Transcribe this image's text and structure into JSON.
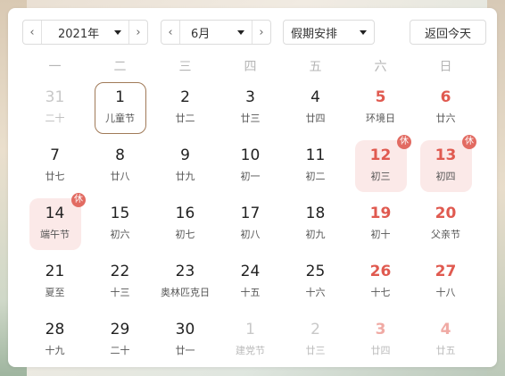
{
  "toolbar": {
    "year_value": "2021年",
    "month_value": "6月",
    "holiday_value": "假期安排",
    "today_label": "返回今天",
    "prev_glyph": "‹",
    "next_glyph": "›"
  },
  "weekdays": [
    "一",
    "二",
    "三",
    "四",
    "五",
    "六",
    "日"
  ],
  "rest_badge": "休",
  "weeks": [
    [
      {
        "day": "31",
        "sub": "二十",
        "type": "other"
      },
      {
        "day": "1",
        "sub": "儿童节",
        "type": "today"
      },
      {
        "day": "2",
        "sub": "廿二",
        "type": "normal"
      },
      {
        "day": "3",
        "sub": "廿三",
        "type": "normal"
      },
      {
        "day": "4",
        "sub": "廿四",
        "type": "normal"
      },
      {
        "day": "5",
        "sub": "环境日",
        "type": "weekend"
      },
      {
        "day": "6",
        "sub": "廿六",
        "type": "weekend"
      }
    ],
    [
      {
        "day": "7",
        "sub": "廿七",
        "type": "normal"
      },
      {
        "day": "8",
        "sub": "廿八",
        "type": "normal"
      },
      {
        "day": "9",
        "sub": "廿九",
        "type": "normal"
      },
      {
        "day": "10",
        "sub": "初一",
        "type": "normal"
      },
      {
        "day": "11",
        "sub": "初二",
        "type": "normal"
      },
      {
        "day": "12",
        "sub": "初三",
        "type": "weekend holiday"
      },
      {
        "day": "13",
        "sub": "初四",
        "type": "weekend holiday"
      }
    ],
    [
      {
        "day": "14",
        "sub": "端午节",
        "type": "holiday"
      },
      {
        "day": "15",
        "sub": "初六",
        "type": "normal"
      },
      {
        "day": "16",
        "sub": "初七",
        "type": "normal"
      },
      {
        "day": "17",
        "sub": "初八",
        "type": "normal"
      },
      {
        "day": "18",
        "sub": "初九",
        "type": "normal"
      },
      {
        "day": "19",
        "sub": "初十",
        "type": "weekend"
      },
      {
        "day": "20",
        "sub": "父亲节",
        "type": "weekend"
      }
    ],
    [
      {
        "day": "21",
        "sub": "夏至",
        "type": "normal"
      },
      {
        "day": "22",
        "sub": "十三",
        "type": "normal"
      },
      {
        "day": "23",
        "sub": "奥林匹克日",
        "type": "normal"
      },
      {
        "day": "24",
        "sub": "十五",
        "type": "normal"
      },
      {
        "day": "25",
        "sub": "十六",
        "type": "normal"
      },
      {
        "day": "26",
        "sub": "十七",
        "type": "weekend"
      },
      {
        "day": "27",
        "sub": "十八",
        "type": "weekend"
      }
    ],
    [
      {
        "day": "28",
        "sub": "十九",
        "type": "normal"
      },
      {
        "day": "29",
        "sub": "二十",
        "type": "normal"
      },
      {
        "day": "30",
        "sub": "廿一",
        "type": "normal"
      },
      {
        "day": "1",
        "sub": "建党节",
        "type": "other"
      },
      {
        "day": "2",
        "sub": "廿三",
        "type": "other"
      },
      {
        "day": "3",
        "sub": "廿四",
        "type": "other weekend"
      },
      {
        "day": "4",
        "sub": "廿五",
        "type": "other weekend"
      }
    ]
  ],
  "colors": {
    "weekend_red": "#e05a50",
    "holiday_bg": "#fbe9e8",
    "badge_bg": "#e26b62",
    "today_border": "#a07a58"
  }
}
